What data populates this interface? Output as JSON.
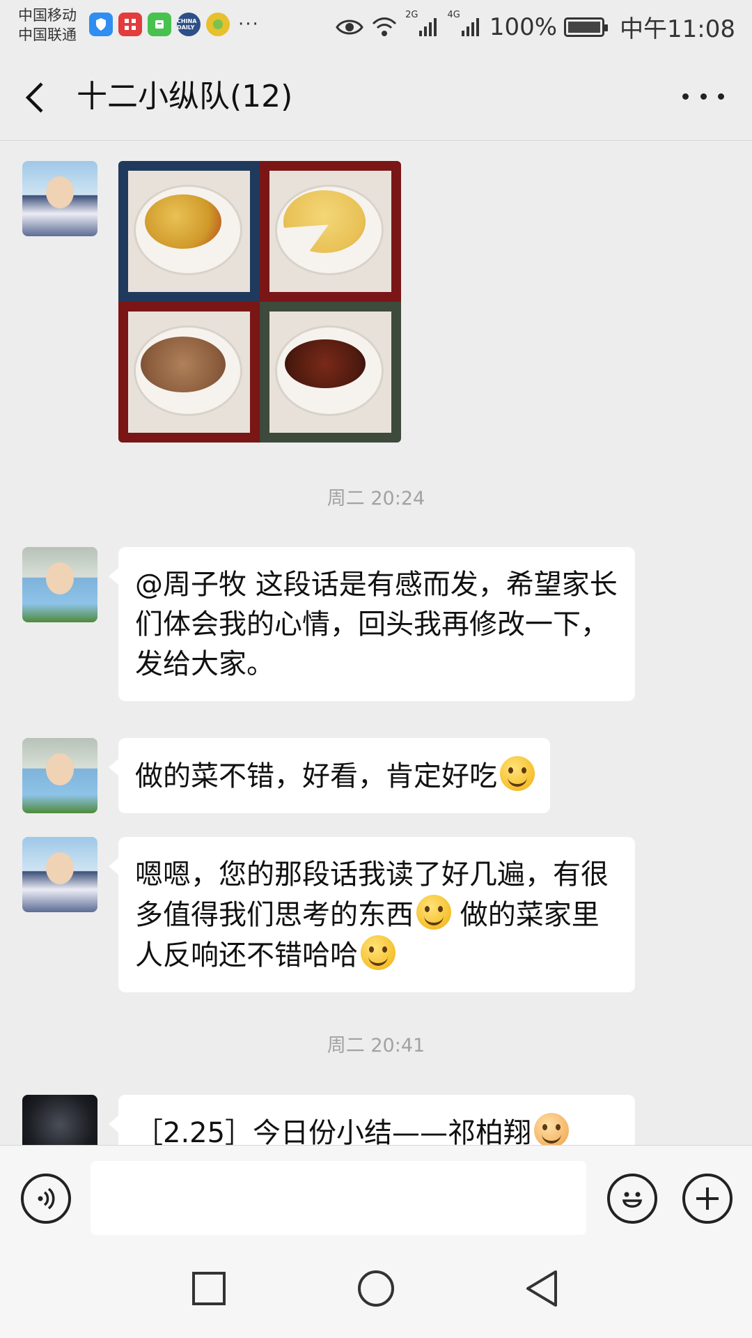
{
  "status_bar": {
    "carrier_1": "中国移动",
    "carrier_2": "中国联通",
    "app_icons": [
      "shield-icon",
      "grid-app-icon",
      "notes-app-icon",
      "china-daily-icon",
      "ball-app-icon"
    ],
    "china_daily_label": "CHINA DAILY",
    "more": "···",
    "signal_2g": "2G",
    "signal_4g": "4G",
    "battery": "100%",
    "time": "中午11:08"
  },
  "header": {
    "title": "十二小纵队(12)"
  },
  "messages": [
    {
      "type": "image-grid",
      "sender": "teacher",
      "tiles": [
        "tomato-potato",
        "cake",
        "fried-meat",
        "braised-wings"
      ]
    },
    {
      "type": "time",
      "text": "周二 20:24"
    },
    {
      "type": "text",
      "sender": "child",
      "text": "@周子牧  这段话是有感而发，希望家长们体会我的心情，回头我再修改一下，发给大家。"
    },
    {
      "type": "text",
      "sender": "child",
      "text": "做的菜不错，好看，肯定好吃",
      "emoji": "grin-emoji"
    },
    {
      "type": "text",
      "sender": "teacher",
      "text_a": "嗯嗯，您的那段话我读了好几遍，有很多值得我们思考的东西",
      "emoji_a": "thinking-emoji",
      "text_b": " 做的菜家里人反响还不错哈哈",
      "emoji_b": "shy-emoji"
    },
    {
      "type": "time",
      "text": "周二 20:41"
    },
    {
      "type": "text",
      "sender": "dark-avatar",
      "text": "［2.25］今日份小结——祁柏翔",
      "emoji": "dog-emoji"
    }
  ],
  "input_bar": {
    "placeholder": ""
  },
  "colors": {
    "background": "#ededed",
    "bubble": "#ffffff",
    "timestamp": "#a2a2a2"
  }
}
